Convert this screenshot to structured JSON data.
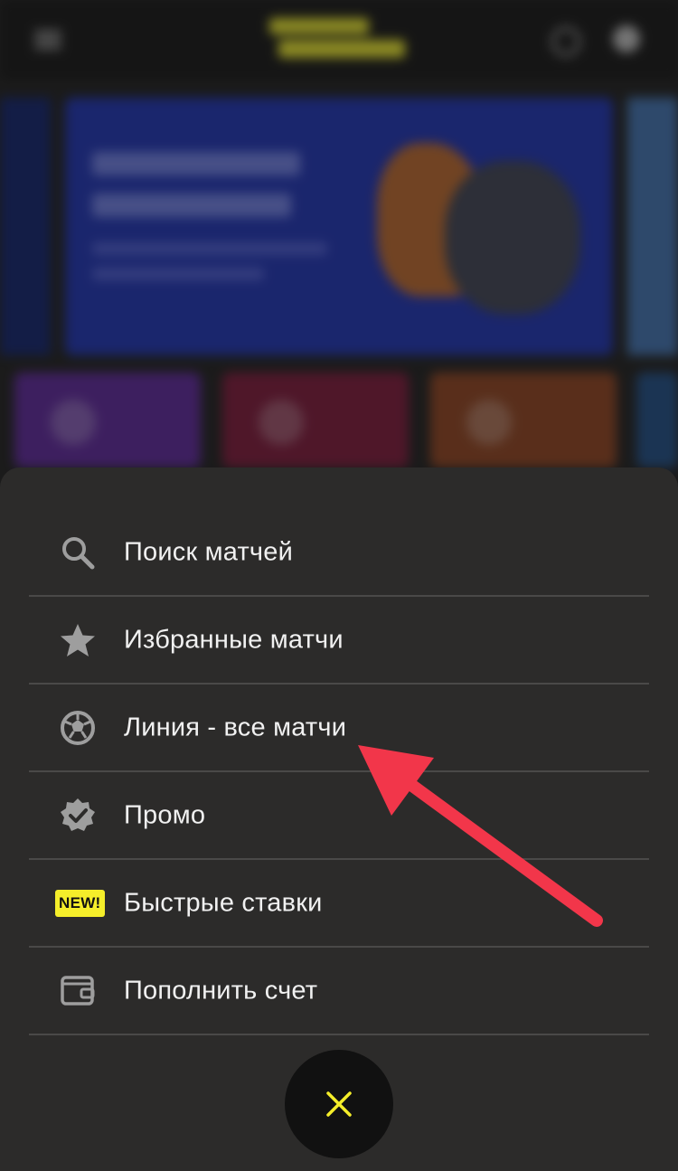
{
  "menu": {
    "items": [
      {
        "label": "Поиск матчей",
        "icon": "search-icon"
      },
      {
        "label": "Избранные матчи",
        "icon": "star-icon"
      },
      {
        "label": "Линия - все матчи",
        "icon": "soccer-ball-icon"
      },
      {
        "label": "Промо",
        "icon": "verified-badge-icon"
      },
      {
        "label": "Быстрые ставки",
        "icon": "new-badge-icon",
        "badge": "NEW!"
      },
      {
        "label": "Пополнить счет",
        "icon": "wallet-icon"
      }
    ]
  },
  "close_button": {
    "icon": "close-icon"
  },
  "colors": {
    "sheet_bg": "#2c2b2a",
    "accent_yellow": "#f5ee2a",
    "arrow_red": "#f2364a",
    "divider": "#4a4948",
    "icon_gray": "#9e9e9e"
  }
}
